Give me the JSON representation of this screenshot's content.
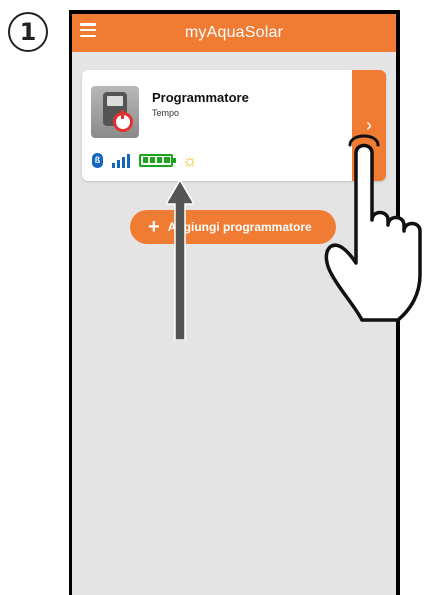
{
  "step": {
    "number": "1"
  },
  "app": {
    "title": "myAquaSolar",
    "accent_color": "#f07c33"
  },
  "device_card": {
    "name": "Programmatore",
    "type": "Tempo",
    "device_icon": "irrigation-controller-icon",
    "status": {
      "bluetooth": "bluetooth-icon",
      "signal_bars": 4,
      "battery_segments": 4,
      "weather": "sun-icon"
    }
  },
  "add_button": {
    "label": "Aggiungi programmatore"
  }
}
